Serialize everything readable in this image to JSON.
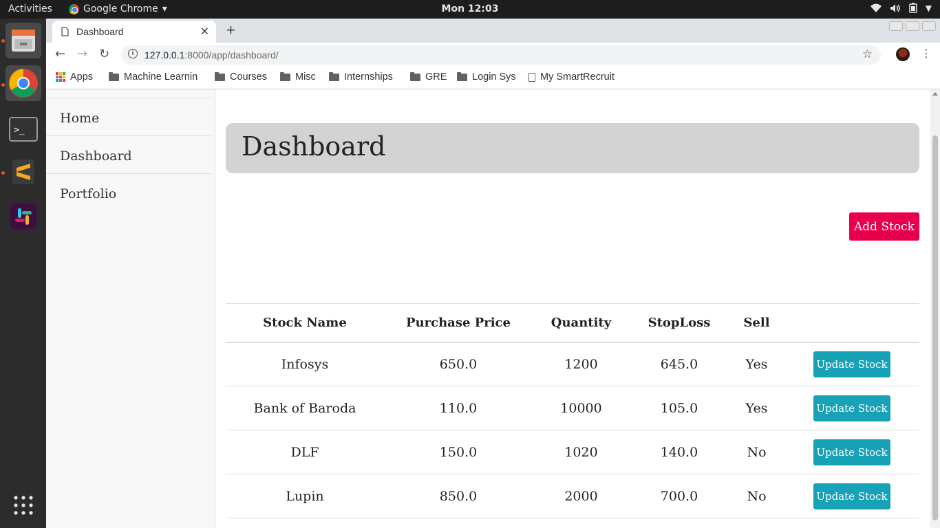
{
  "topbar": {
    "activities": "Activities",
    "app_name": "Google Chrome",
    "app_caret": "▾",
    "clock": "Mon 12:03"
  },
  "tab": {
    "title": "Dashboard",
    "close": "✕",
    "new_tab": "+"
  },
  "toolbar": {
    "back": "←",
    "forward": "→",
    "reload": "↻",
    "url_host": "127.0.0.1",
    "url_rest": ":8000/app/dashboard/",
    "info": "i",
    "star": "☆",
    "menu": "⋮"
  },
  "bookmarks": [
    {
      "label": "Apps",
      "icon": "apps-icon"
    },
    {
      "label": "Machine Learnin",
      "icon": "folder-icon"
    },
    {
      "label": "Courses",
      "icon": "folder-icon"
    },
    {
      "label": "Misc",
      "icon": "folder-icon"
    },
    {
      "label": "Internships",
      "icon": "folder-icon"
    },
    {
      "label": "GRE",
      "icon": "folder-icon"
    },
    {
      "label": "Login Sys",
      "icon": "folder-icon"
    },
    {
      "label": "My SmartRecruit",
      "icon": "page-icon"
    }
  ],
  "sidebar": {
    "items": [
      {
        "label": "Home"
      },
      {
        "label": "Dashboard"
      },
      {
        "label": "Portfolio"
      }
    ]
  },
  "main": {
    "title": "Dashboard",
    "add_button": "Add Stock",
    "table": {
      "headers": [
        "Stock Name",
        "Purchase Price",
        "Quantity",
        "StopLoss",
        "Sell",
        ""
      ],
      "rows": [
        {
          "name": "Infosys",
          "price": "650.0",
          "qty": "1200",
          "stoploss": "645.0",
          "sell": "Yes",
          "action": "Update Stock"
        },
        {
          "name": "Bank of Baroda",
          "price": "110.0",
          "qty": "10000",
          "stoploss": "105.0",
          "sell": "Yes",
          "action": "Update Stock"
        },
        {
          "name": "DLF",
          "price": "150.0",
          "qty": "1020",
          "stoploss": "140.0",
          "sell": "No",
          "action": "Update Stock"
        },
        {
          "name": "Lupin",
          "price": "850.0",
          "qty": "2000",
          "stoploss": "700.0",
          "sell": "No",
          "action": "Update Stock"
        }
      ]
    }
  },
  "colors": {
    "add_button": "#e8004c",
    "update_button": "#17a2b8",
    "jumbotron": "#d3d3d3"
  }
}
